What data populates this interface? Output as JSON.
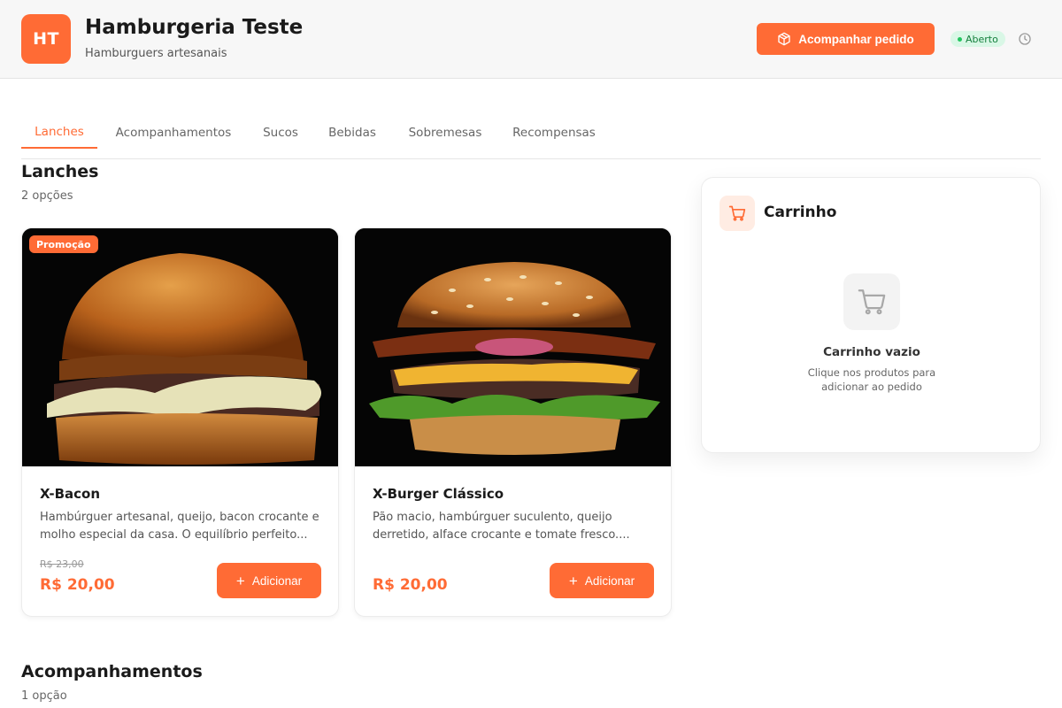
{
  "header": {
    "logo_initials": "HT",
    "store_name": "Hamburgeria Teste",
    "store_subtitle": "Hamburguers artesanais",
    "track_order_label": "Acompanhar pedido",
    "status_label": "Aberto",
    "accent_color": "#ff6b35",
    "status_color": "#22c55e"
  },
  "tabs": [
    {
      "label": "Lanches",
      "active": true
    },
    {
      "label": "Acompanhamentos",
      "active": false
    },
    {
      "label": "Sucos",
      "active": false
    },
    {
      "label": "Bebidas",
      "active": false
    },
    {
      "label": "Sobremesas",
      "active": false
    },
    {
      "label": "Recompensas",
      "active": false
    }
  ],
  "sections": [
    {
      "title": "Lanches",
      "count": "2 opções"
    },
    {
      "title": "Acompanhamentos",
      "count": "1 opção"
    }
  ],
  "products": [
    {
      "badge": "Promoção",
      "name": "X-Bacon",
      "description": "Hambúrguer artesanal, queijo, bacon crocante e molho especial da casa. O equilíbrio perfeito...",
      "old_price": "R$ 23,00",
      "price": "R$ 20,00",
      "add_label": "Adicionar"
    },
    {
      "name": "X-Burger Clássico",
      "description": "Pão macio, hambúrguer suculento, queijo derretido, alface crocante e tomate fresco....",
      "price": "R$ 20,00",
      "add_label": "Adicionar"
    }
  ],
  "cart": {
    "title": "Carrinho",
    "empty_title": "Carrinho vazio",
    "empty_subtitle": "Clique nos produtos para adicionar ao pedido"
  },
  "icons": {
    "track": "package-icon",
    "clock": "clock-icon",
    "cart": "cart-icon",
    "add": "plus-icon"
  }
}
